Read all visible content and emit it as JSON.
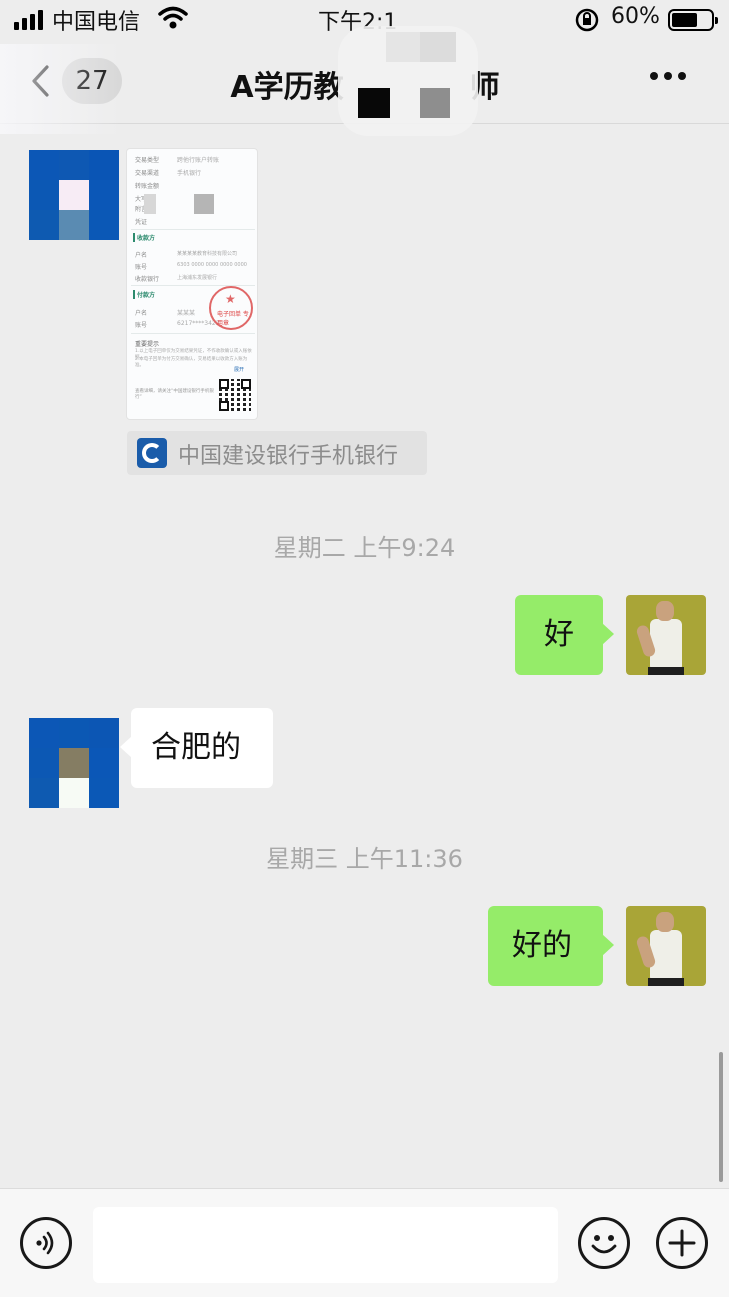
{
  "status_bar": {
    "carrier": "中国电信",
    "time": "下午2:1",
    "battery_percent": "60%",
    "battery_level": 0.6
  },
  "nav": {
    "unread_badge": "27",
    "title_left": "A学历教",
    "title_right": "师"
  },
  "receipt": {
    "fields": [
      {
        "label": "交易类型",
        "value": "跨他行账户转账"
      },
      {
        "label": "交易渠道",
        "value": "手机银行"
      },
      {
        "label": "转账金额",
        "value": ""
      },
      {
        "label": "大写",
        "value": ""
      },
      {
        "label": "附言",
        "value": ""
      },
      {
        "label": "凭证",
        "value": ""
      }
    ],
    "payee_section": "收款方",
    "payee": [
      {
        "label": "户名",
        "value": "某某某某教育科技有限公司"
      },
      {
        "label": "账号",
        "value": "6303 0000 0000 0000 0000"
      },
      {
        "label": "收款银行",
        "value": "上海浦东发展银行"
      }
    ],
    "payer_section": "付款方",
    "payer": [
      {
        "label": "户名",
        "value": "某某某"
      },
      {
        "label": "账号",
        "value": "6217****3422"
      }
    ],
    "tip_title": "重要提示",
    "tip_text": "1.以上电子回单仅为交易结果凭证，不作收款确认或入账依据。",
    "tip_text2": "2.本电子回单为付方交易确认，交易结果以收款方入账为准。",
    "stamp_text": "电子回单 专用章",
    "footer": "查看详细，请关注“中国建设银行手机银行”",
    "more_link": "展开"
  },
  "source_tag": {
    "label": "中国建设银行手机银行"
  },
  "messages": [
    {
      "type": "timestamp",
      "text": "星期二 上午9:24"
    },
    {
      "type": "out",
      "text": "好"
    },
    {
      "type": "in",
      "text": "合肥的"
    },
    {
      "type": "timestamp",
      "text": "星期三 上午11:36"
    },
    {
      "type": "out",
      "text": "好的"
    }
  ],
  "input_bar": {
    "placeholder": ""
  },
  "colors": {
    "outgoing_bubble": "#95ec69",
    "incoming_bubble": "#ffffff",
    "background": "#ededed",
    "ccb_blue": "#1a5caa"
  }
}
